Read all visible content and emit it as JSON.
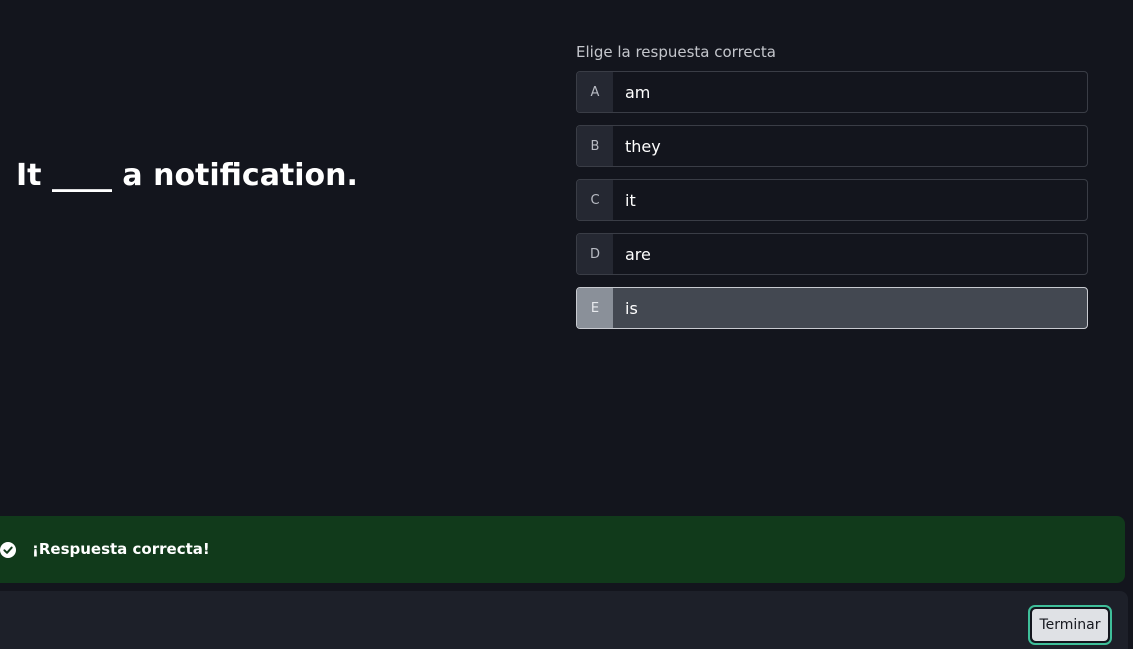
{
  "question": {
    "text": "It ____ a notification."
  },
  "answers": {
    "prompt": "Elige la respuesta correcta",
    "options": [
      {
        "letter": "A",
        "text": "am"
      },
      {
        "letter": "B",
        "text": "they"
      },
      {
        "letter": "C",
        "text": "it"
      },
      {
        "letter": "D",
        "text": "are"
      },
      {
        "letter": "E",
        "text": "is"
      }
    ],
    "selected": "E"
  },
  "feedback": {
    "icon": "check-circle-icon",
    "message": "¡Respuesta correcta!",
    "color": "#113a1b"
  },
  "footer": {
    "finish_label": "Terminar",
    "accent": "#3fbf9a"
  }
}
